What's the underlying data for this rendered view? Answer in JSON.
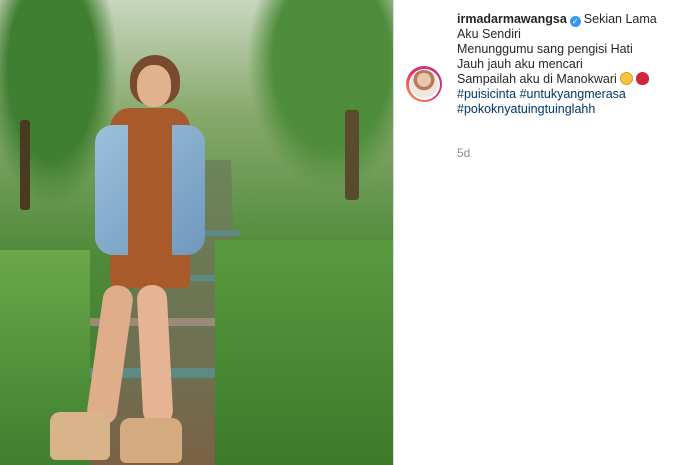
{
  "post": {
    "username": "irmadarmawangsa",
    "verified_icon": "verified-badge-icon",
    "caption_lines": [
      "Sekian Lama",
      "Aku Sendiri",
      "Menunggumu sang pengisi Hati",
      "Jauh jauh aku mencari",
      "Sampailah aku di Manokwari"
    ],
    "emoji_icons": [
      "blushing-face-icon",
      "kiss-lips-icon"
    ],
    "hashtags_line1": [
      "#puisicinta",
      "#untukyangmerasa"
    ],
    "hashtags_line2": [
      "#pokoknyatuingtuinglahh"
    ],
    "timestamp": "5d"
  },
  "colors": {
    "hashtag": "#00376b",
    "verified": "#3897f0",
    "muted": "#8e8e8e",
    "divider": "#dbdbdb"
  }
}
